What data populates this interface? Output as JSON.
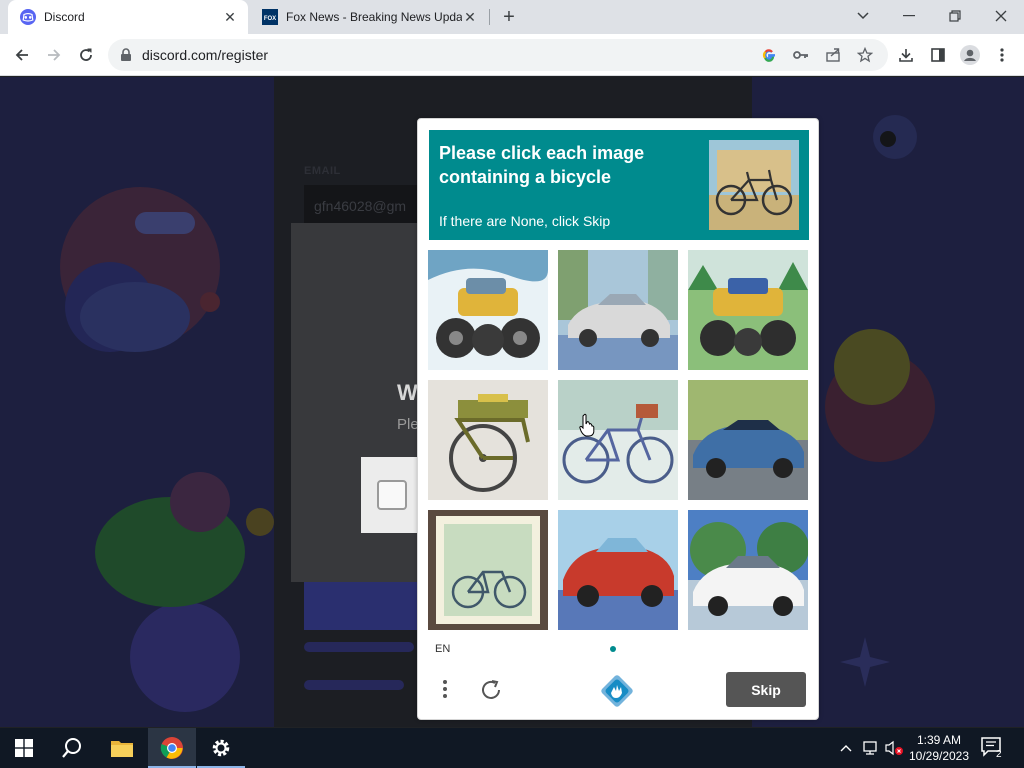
{
  "browser": {
    "tabs": [
      {
        "title": "Discord",
        "active": true,
        "favicon": "discord-icon"
      },
      {
        "title": "Fox News - Breaking News Upda",
        "active": false,
        "favicon": "fox-news-icon"
      }
    ],
    "url": "discord.com/register"
  },
  "background_page": {
    "email_label": "EMAIL",
    "email_value": "gfn46028@gm",
    "modal_heading": "W",
    "modal_subtext": "Ple"
  },
  "captcha": {
    "prompt_title": "Please click each image containing a bicycle",
    "prompt_subtitle": "If there are None, click Skip",
    "tiles": [
      {
        "subject": "monster truck"
      },
      {
        "subject": "silver vintage car"
      },
      {
        "subject": "blue monster truck"
      },
      {
        "subject": "yellow-green bicycle"
      },
      {
        "subject": "blue bicycle with basket"
      },
      {
        "subject": "blue sports car"
      },
      {
        "subject": "framed bicycle painting"
      },
      {
        "subject": "red vintage car"
      },
      {
        "subject": "white car"
      }
    ],
    "language": "EN",
    "skip_label": "Skip",
    "accent_color": "#008b8e"
  },
  "taskbar": {
    "time": "1:39 AM",
    "date": "10/29/2023",
    "notification_count": "2"
  }
}
